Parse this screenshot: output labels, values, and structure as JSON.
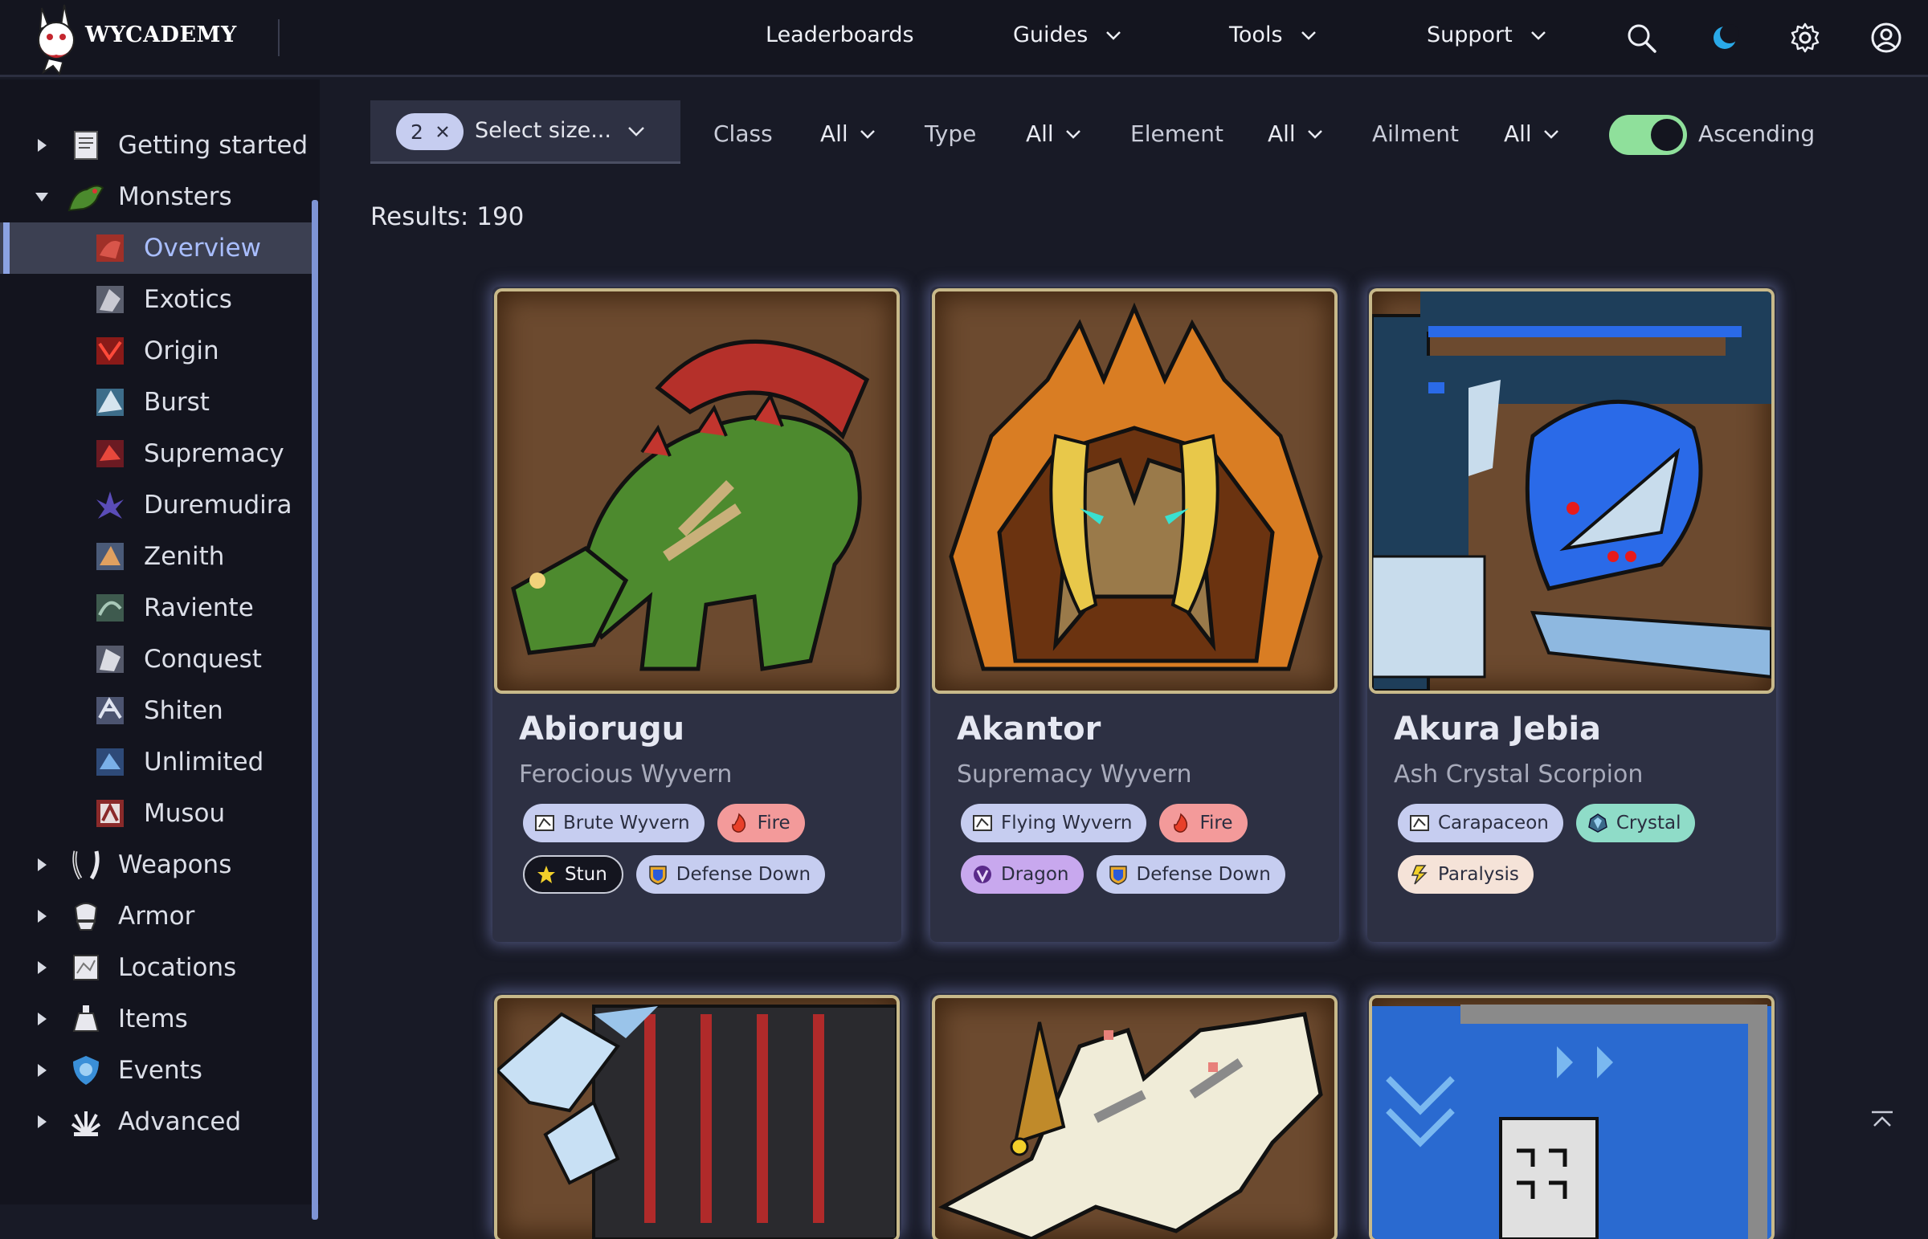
{
  "header": {
    "brand": "WYCADEMY",
    "nav": [
      {
        "label": "Leaderboards",
        "has_menu": false
      },
      {
        "label": "Guides",
        "has_menu": true
      },
      {
        "label": "Tools",
        "has_menu": true
      },
      {
        "label": "Support",
        "has_menu": true
      }
    ],
    "icons": [
      "search-icon",
      "theme-moon-icon",
      "settings-gear-icon",
      "account-icon"
    ]
  },
  "sidebar": {
    "items": [
      {
        "label": "Getting started",
        "expanded": false
      },
      {
        "label": "Monsters",
        "expanded": true
      },
      {
        "label": "Overview",
        "active": true
      },
      {
        "label": "Exotics"
      },
      {
        "label": "Origin"
      },
      {
        "label": "Burst"
      },
      {
        "label": "Supremacy"
      },
      {
        "label": "Duremudira"
      },
      {
        "label": "Zenith"
      },
      {
        "label": "Raviente"
      },
      {
        "label": "Conquest"
      },
      {
        "label": "Shiten"
      },
      {
        "label": "Unlimited"
      },
      {
        "label": "Musou"
      },
      {
        "label": "Weapons",
        "expanded": false
      },
      {
        "label": "Armor",
        "expanded": false
      },
      {
        "label": "Locations",
        "expanded": false
      },
      {
        "label": "Items",
        "expanded": false
      },
      {
        "label": "Events",
        "expanded": false
      },
      {
        "label": "Advanced",
        "expanded": false
      }
    ]
  },
  "filters": {
    "size_count": "2",
    "size_placeholder": "Select size...",
    "class_label": "Class",
    "class_value": "All",
    "type_label": "Type",
    "type_value": "All",
    "element_label": "Element",
    "element_value": "All",
    "ailment_label": "Ailment",
    "ailment_value": "All",
    "ascending_label": "Ascending",
    "ascending_on": true
  },
  "results_text": "Results: 190",
  "cards": [
    {
      "name": "Abiorugu",
      "subtitle": "Ferocious Wyvern",
      "tags": [
        {
          "label": "Brute Wyvern",
          "color": "#c6cdf0"
        },
        {
          "label": "Fire",
          "color": "#f39a9a"
        },
        {
          "label": "Stun",
          "color": "#14151f"
        },
        {
          "label": "Defense Down",
          "color": "#c6cdf0"
        }
      ]
    },
    {
      "name": "Akantor",
      "subtitle": "Supremacy Wyvern",
      "tags": [
        {
          "label": "Flying Wyvern",
          "color": "#c6cdf0"
        },
        {
          "label": "Fire",
          "color": "#f39a9a"
        },
        {
          "label": "Dragon",
          "color": "#c8a8ee"
        },
        {
          "label": "Defense Down",
          "color": "#c6cdf0"
        }
      ]
    },
    {
      "name": "Akura Jebia",
      "subtitle": "Ash Crystal Scorpion",
      "tags": [
        {
          "label": "Carapaceon",
          "color": "#c6cdf0"
        },
        {
          "label": "Crystal",
          "color": "#8fdcc8"
        },
        {
          "label": "Paralysis",
          "color": "#f5e3d8"
        }
      ]
    }
  ]
}
